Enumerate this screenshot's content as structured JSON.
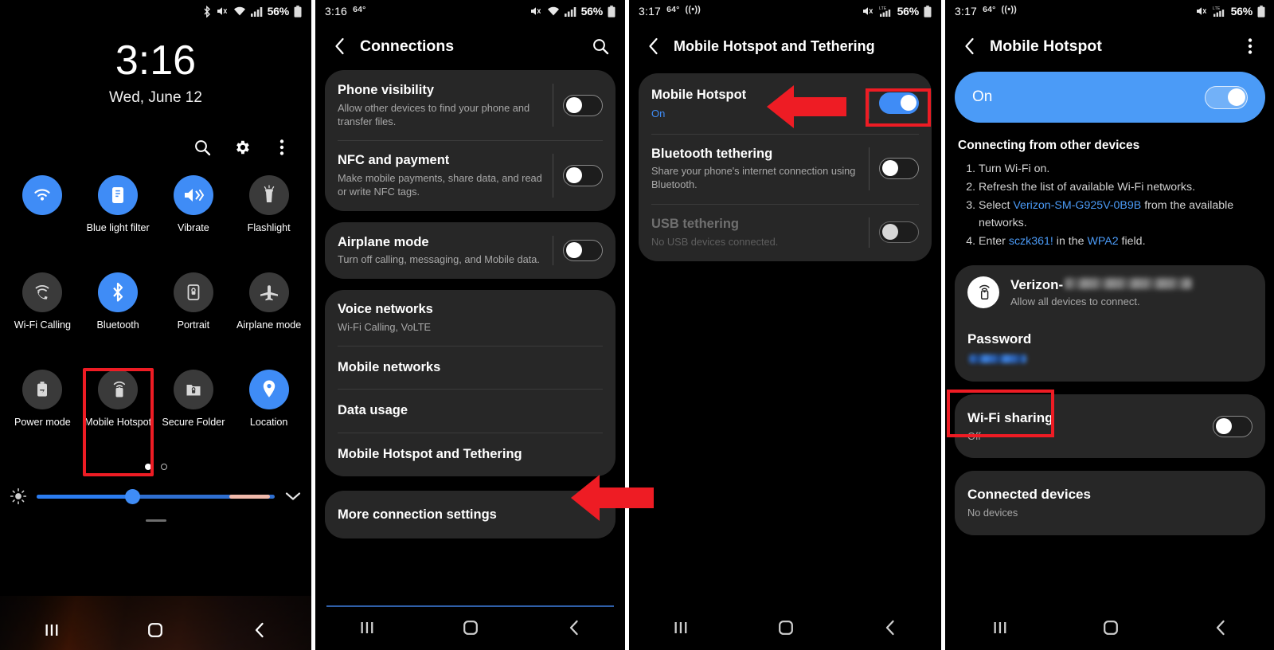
{
  "panels": {
    "quick_settings": {
      "status": {
        "time_hidden": "",
        "battery": "56%",
        "icons": [
          "bluetooth-icon",
          "mute-vibrate-icon",
          "wifi-icon",
          "signal-icon",
          "battery-icon"
        ]
      },
      "clock": {
        "time": "3:16",
        "date": "Wed, June 12"
      },
      "actions": [
        "search-icon",
        "gear-icon",
        "more-vertical-icon"
      ],
      "tiles": [
        {
          "label": "",
          "icon": "wifi-icon",
          "state": "on",
          "redacted": true
        },
        {
          "label": "Blue light filter",
          "icon": "blue-light-icon",
          "state": "on"
        },
        {
          "label": "Vibrate",
          "icon": "vibrate-icon",
          "state": "on"
        },
        {
          "label": "Flashlight",
          "icon": "flashlight-icon",
          "state": "off"
        },
        {
          "label": "Wi-Fi Calling",
          "icon": "wifi-calling-icon",
          "state": "off"
        },
        {
          "label": "Bluetooth",
          "icon": "bluetooth-icon",
          "state": "on"
        },
        {
          "label": "Portrait",
          "icon": "screen-rotation-lock-icon",
          "state": "off"
        },
        {
          "label": "Airplane mode",
          "icon": "airplane-icon",
          "state": "off"
        },
        {
          "label": "Power mode",
          "icon": "power-mode-icon",
          "state": "off"
        },
        {
          "label": "Mobile Hotspot",
          "icon": "hotspot-icon",
          "state": "off",
          "highlighted": true
        },
        {
          "label": "Secure Folder",
          "icon": "secure-folder-icon",
          "state": "off"
        },
        {
          "label": "Location",
          "icon": "location-pin-icon",
          "state": "on"
        }
      ],
      "pager": {
        "pages": 2,
        "active": 1
      },
      "brightness": {
        "icon": "brightness-icon",
        "value_percent": 40,
        "expand_icon": "chevron-down-icon"
      },
      "nav": [
        "recents-icon",
        "home-icon",
        "back-icon"
      ]
    },
    "connections": {
      "status": {
        "time": "3:16",
        "temp": "64°",
        "battery": "56%"
      },
      "appbar": {
        "title": "Connections",
        "back": "back-arrow-icon",
        "action": "search-icon"
      },
      "groups": [
        {
          "rows": [
            {
              "title": "Phone visibility",
              "subtitle": "Allow other devices to find your phone and transfer files.",
              "toggle": "off"
            },
            {
              "title": "NFC and payment",
              "subtitle": "Make mobile payments, share data, and read or write NFC tags.",
              "toggle": "off"
            }
          ]
        },
        {
          "rows": [
            {
              "title": "Airplane mode",
              "subtitle": "Turn off calling, messaging, and Mobile data.",
              "toggle": "off"
            }
          ]
        },
        {
          "rows": [
            {
              "title": "Voice networks",
              "subtitle": "Wi-Fi Calling, VoLTE"
            },
            {
              "title": "Mobile networks",
              "subtitle": ""
            },
            {
              "title": "Data usage",
              "subtitle": ""
            },
            {
              "title": "Mobile Hotspot and Tethering",
              "subtitle": "",
              "arrow_callout": true
            }
          ]
        },
        {
          "rows": [
            {
              "title": "More connection settings",
              "subtitle": ""
            }
          ]
        }
      ],
      "nav": [
        "recents-icon",
        "home-icon",
        "back-icon"
      ]
    },
    "hotspot_tethering": {
      "status": {
        "time": "3:17",
        "temp": "64°",
        "cast": "((•))",
        "battery": "56%"
      },
      "appbar": {
        "title": "Mobile Hotspot and Tethering",
        "back": "back-arrow-icon"
      },
      "rows": [
        {
          "title": "Mobile Hotspot",
          "subtitle": "On",
          "subtitle_style": "blue",
          "toggle": "on",
          "highlighted": true,
          "arrow_callout": true
        },
        {
          "title": "Bluetooth tethering",
          "subtitle": "Share your phone's internet connection using Bluetooth.",
          "toggle": "off"
        },
        {
          "title": "USB tethering",
          "subtitle": "No USB devices connected.",
          "toggle": "off",
          "disabled": true
        }
      ],
      "nav": [
        "recents-icon",
        "home-icon",
        "back-icon"
      ]
    },
    "mobile_hotspot": {
      "status": {
        "time": "3:17",
        "temp": "64°",
        "cast": "((•))",
        "battery": "56%"
      },
      "appbar": {
        "title": "Mobile Hotspot",
        "back": "back-arrow-icon",
        "action": "more-vertical-icon"
      },
      "master_switch": {
        "label": "On",
        "state": "on"
      },
      "instructions": {
        "heading": "Connecting from other devices",
        "steps": [
          {
            "prefix": "Turn Wi-Fi on.",
            "link": "",
            "suffix": ""
          },
          {
            "prefix": "Refresh the list of available Wi-Fi networks.",
            "link": "",
            "suffix": ""
          },
          {
            "prefix": "Select ",
            "link": "Verizon-SM-G925V-0B9B",
            "suffix": " from the available networks."
          },
          {
            "prefix": "Enter ",
            "link": "sczk361!",
            "suffix": " in the ",
            "link2": "WPA2",
            "suffix2": " field."
          }
        ]
      },
      "network": {
        "icon": "hotspot-icon",
        "name_prefix": "Verizon-",
        "name_redacted": true,
        "subtitle": "Allow all devices to connect."
      },
      "password": {
        "label": "Password",
        "value_redacted": true,
        "highlighted": true
      },
      "wifi_sharing": {
        "title": "Wi-Fi sharing",
        "subtitle": "Off",
        "toggle": "off"
      },
      "connected_devices": {
        "title": "Connected devices",
        "subtitle": "No devices"
      },
      "nav": [
        "recents-icon",
        "home-icon",
        "back-icon"
      ]
    }
  }
}
